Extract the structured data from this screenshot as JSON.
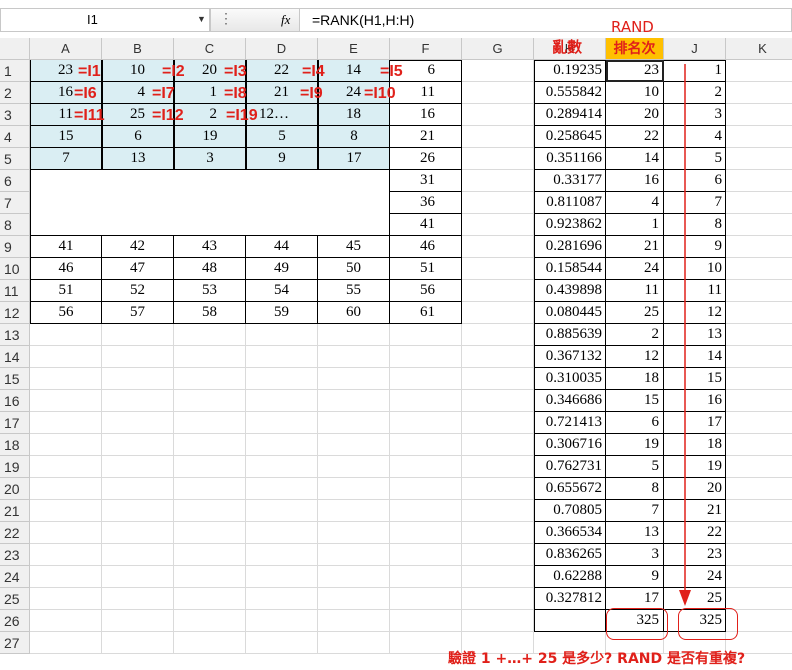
{
  "formula_bar": {
    "name_box": "I1",
    "formula": "=RANK(H1,H:H)"
  },
  "columns": [
    "A",
    "B",
    "C",
    "D",
    "E",
    "F",
    "G",
    "H",
    "I",
    "J",
    "K"
  ],
  "rows": [
    "1",
    "2",
    "3",
    "4",
    "5",
    "6",
    "7",
    "8",
    "9",
    "10",
    "11",
    "12",
    "13",
    "14",
    "15",
    "16",
    "17",
    "18",
    "19",
    "20",
    "21",
    "22",
    "23",
    "24",
    "25",
    "26",
    "27"
  ],
  "grid_a_e": [
    [
      "23",
      "10",
      "20",
      "22",
      "14"
    ],
    [
      "16",
      "4",
      "1",
      "21",
      "24"
    ],
    [
      "11",
      "25",
      "2",
      "12…",
      "18"
    ],
    [
      "15",
      "6",
      "19",
      "5",
      "8"
    ],
    [
      "7",
      "13",
      "3",
      "9",
      "17"
    ]
  ],
  "annotations": [
    [
      "=I1",
      "=I2",
      "=I3",
      "=I4",
      "=I5"
    ],
    [
      "=I6",
      "=I7",
      "=I8",
      "=I9",
      "=I10"
    ],
    [
      "=I11",
      "=I12",
      "=I19",
      "",
      ""
    ]
  ],
  "grid_a_e_lower": [
    [
      "41",
      "42",
      "43",
      "44",
      "45"
    ],
    [
      "46",
      "47",
      "48",
      "49",
      "50"
    ],
    [
      "51",
      "52",
      "53",
      "54",
      "55"
    ],
    [
      "56",
      "57",
      "58",
      "59",
      "60"
    ]
  ],
  "col_f": [
    "6",
    "11",
    "16",
    "21",
    "26",
    "31",
    "36",
    "41",
    "46",
    "51",
    "56",
    "61"
  ],
  "col_h": [
    "0.19235",
    "0.555842",
    "0.289414",
    "0.258645",
    "0.351166",
    "0.33177",
    "0.811087",
    "0.923862",
    "0.281696",
    "0.158544",
    "0.439898",
    "0.080445",
    "0.885639",
    "0.367132",
    "0.310035",
    "0.346686",
    "0.721413",
    "0.306716",
    "0.762731",
    "0.655672",
    "0.70805",
    "0.366534",
    "0.836265",
    "0.62288",
    "0.327812"
  ],
  "col_i": [
    "23",
    "10",
    "20",
    "22",
    "14",
    "16",
    "4",
    "1",
    "21",
    "24",
    "11",
    "25",
    "2",
    "12",
    "18",
    "15",
    "6",
    "19",
    "5",
    "8",
    "7",
    "13",
    "3",
    "9",
    "17"
  ],
  "col_j": [
    "1",
    "2",
    "3",
    "4",
    "5",
    "6",
    "7",
    "8",
    "9",
    "10",
    "11",
    "12",
    "13",
    "14",
    "15",
    "16",
    "17",
    "18",
    "19",
    "20",
    "21",
    "22",
    "23",
    "24",
    "25"
  ],
  "sum_i": "325",
  "sum_j": "325",
  "labels": {
    "rand_label": "RAND",
    "random_label": "亂數",
    "rank_label": "排名次",
    "h_col_letter": "H"
  },
  "note": "驗證 1 +…+ 25 是多少? RAND 是否有重複?",
  "colors": {
    "accent_red": "#e0201a",
    "highlight_blue": "#daeef3",
    "highlight_orange": "#ffc000"
  }
}
